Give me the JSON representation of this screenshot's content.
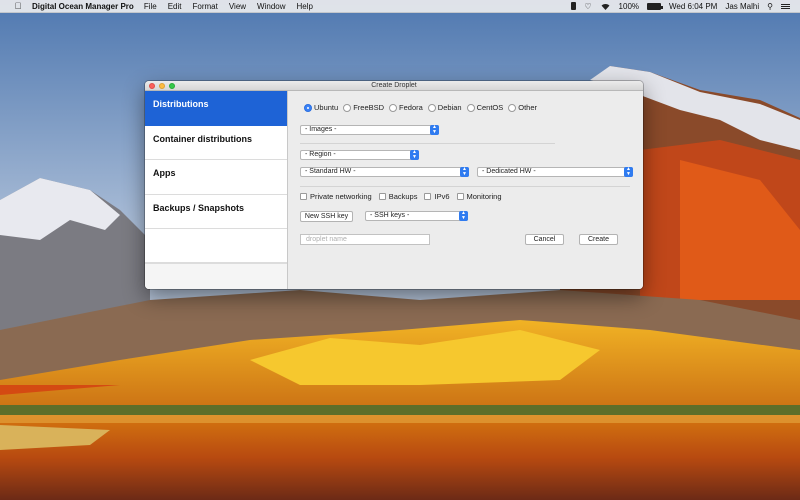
{
  "menubar": {
    "app_name": "Digital Ocean Manager Pro",
    "menus": [
      "File",
      "Edit",
      "Format",
      "View",
      "Window",
      "Help"
    ],
    "battery": "100%",
    "clock": "Wed 6:04 PM",
    "user": "Jas Malhi"
  },
  "window": {
    "title": "Create Droplet",
    "sidebar": [
      {
        "label": "Distributions",
        "selected": true
      },
      {
        "label": "Container distributions",
        "selected": false
      },
      {
        "label": "Apps",
        "selected": false
      },
      {
        "label": "Backups / Snapshots",
        "selected": false
      }
    ],
    "distros": [
      {
        "label": "Ubuntu",
        "selected": true
      },
      {
        "label": "FreeBSD",
        "selected": false
      },
      {
        "label": "Fedora",
        "selected": false
      },
      {
        "label": "Debian",
        "selected": false
      },
      {
        "label": "CentOS",
        "selected": false
      },
      {
        "label": "Other",
        "selected": false
      }
    ],
    "images_popup": "- Images -",
    "region_popup": "- Region -",
    "standard_hw_popup": "- Standard HW -",
    "dedicated_hw_popup": "- Dedicated HW -",
    "options": [
      {
        "label": "Private networking",
        "checked": false
      },
      {
        "label": "Backups",
        "checked": false
      },
      {
        "label": "IPv6",
        "checked": false
      },
      {
        "label": "Monitoring",
        "checked": false
      }
    ],
    "new_ssh_key_button": "New SSH key",
    "ssh_keys_popup": "- SSH keys -",
    "droplet_name_placeholder": "droplet name",
    "cancel_button": "Cancel",
    "create_button": "Create"
  },
  "colors": {
    "selection_blue": "#1e63d6",
    "popup_arrow_blue": "#2f7bf0",
    "close": "#fc605c",
    "minimize": "#fdbc40",
    "maximize": "#34c84a"
  }
}
